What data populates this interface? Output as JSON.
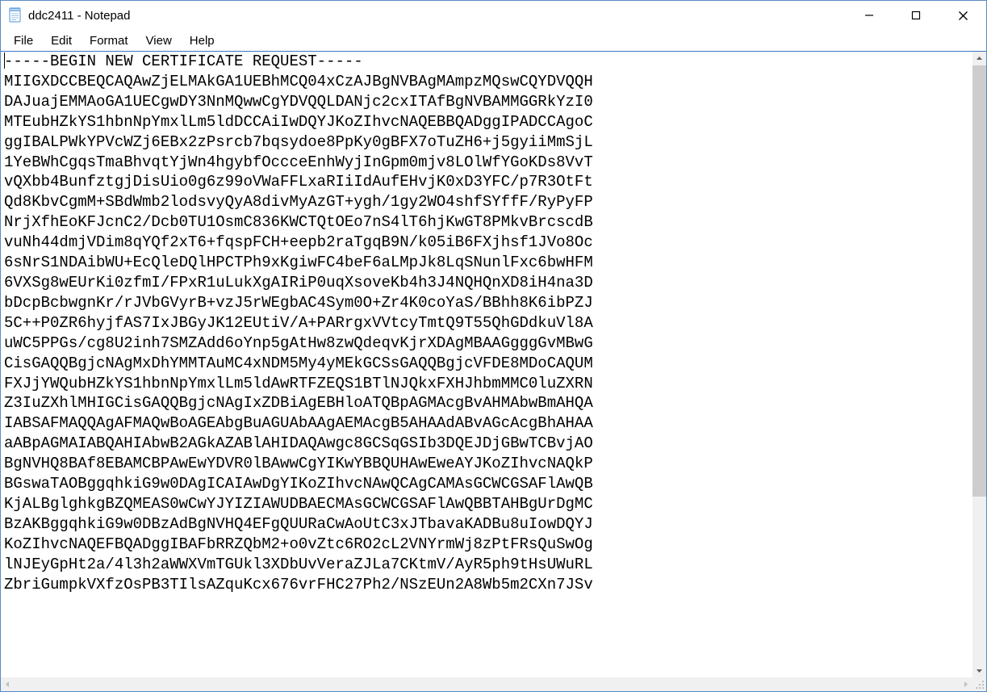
{
  "window": {
    "title": "ddc2411 - Notepad"
  },
  "menubar": {
    "items": [
      "File",
      "Edit",
      "Format",
      "View",
      "Help"
    ]
  },
  "editor": {
    "content": "-----BEGIN NEW CERTIFICATE REQUEST-----\nMIIGXDCCBEQCAQAwZjELMAkGA1UEBhMCQ04xCzAJBgNVBAgMAmpzMQswCQYDVQQH\nDAJuajEMMAoGA1UECgwDY3NnMQwwCgYDVQQLDANjc2cxITAfBgNVBAMMGGRkYzI0\nMTEubHZkYS1hbnNpYmxlLm5ldDCCAiIwDQYJKoZIhvcNAQEBBQADggIPADCCAgoC\nggIBALPWkYPVcWZj6EBx2zPsrcb7bqsydoe8PpKy0gBFX7oTuZH6+j5gyiiMmSjL\n1YeBWhCgqsTmaBhvqtYjWn4hgybfOccceEnhWyjInGpm0mjv8LOlWfYGoKDs8VvT\nvQXbb4BunfztgjDisUio0g6z99oVWaFFLxaRIiIdAufEHvjK0xD3YFC/p7R3OtFt\nQd8KbvCgmM+SBdWmb2lodsvyQyA8divMyAzGT+ygh/1gy2WO4shfSYffF/RyPyFP\nNrjXfhEoKFJcnC2/Dcb0TU1OsmC836KWCTQtOEo7nS4lT6hjKwGT8PMkvBrcscdB\nvuNh44dmjVDim8qYQf2xT6+fqspFCH+eepb2raTgqB9N/k05iB6FXjhsf1JVo8Oc\n6sNrS1NDAibWU+EcQleDQlHPCTPh9xKgiwFC4beF6aLMpJk8LqSNunlFxc6bwHFM\n6VXSg8wEUrKi0zfmI/FPxR1uLukXgAIRiP0uqXsoveKb4h3J4NQHQnXD8iH4na3D\nbDcpBcbwgnKr/rJVbGVyrB+vzJ5rWEgbAC4Sym0O+Zr4K0coYaS/BBhh8K6ibPZJ\n5C++P0ZR6hyjfAS7IxJBGyJK12EUtiV/A+PARrgxVVtcyTmtQ9T55QhGDdkuVl8A\nuWC5PPGs/cg8U2inh7SMZAdd6oYnp5gAtHw8zwQdeqvKjrXDAgMBAAGgggGvMBwG\nCisGAQQBgjcNAgMxDhYMMTAuMC4xNDM5My4yMEkGCSsGAQQBgjcVFDE8MDoCAQUM\nFXJjYWQubHZkYS1hbnNpYmxlLm5ldAwRTFZEQS1BTlNJQkxFXHJhbmMMC0luZXRN\nZ3IuZXhlMHIGCisGAQQBgjcNAgIxZDBiAgEBHloATQBpAGMAcgBvAHMAbwBmAHQA\nIABSAFMAQQAgAFMAQwBoAGEAbgBuAGUAbAAgAEMAcgB5AHAAdABvAGcAcgBhAHAA\naABpAGMAIABQAHIAbwB2AGkAZABlAHIDAQAwgc8GCSqGSIb3DQEJDjGBwTCBvjAO\nBgNVHQ8BAf8EBAMCBPAwEwYDVR0lBAwwCgYIKwYBBQUHAwEweAYJKoZIhvcNAQkP\nBGswaTAOBggqhkiG9w0DAgICAIAwDgYIKoZIhvcNAwQCAgCAMAsGCWCGSAFlAwQB\nKjALBglghkgBZQMEAS0wCwYJYIZIAWUDBAECMAsGCWCGSAFlAwQBBTAHBgUrDgMC\nBzAKBggqhkiG9w0DBzAdBgNVHQ4EFgQUURaCwAoUtC3xJTbavaKADBu8uIowDQYJ\nKoZIhvcNAQEFBQADggIBAFbRRZQbM2+o0vZtc6RO2cL2VNYrmWj8zPtFRsQuSwOg\nlNJEyGpHt2a/4l3h2aWWXVmTGUkl3XDbUvVeraZJLa7CKtmV/AyR5ph9tHsUWuRL\nZbriGumpkVXfzOsPB3TIlsAZquKcx676vrFHC27Ph2/NSzEUn2A8Wb5m2CXn7JSv"
  }
}
